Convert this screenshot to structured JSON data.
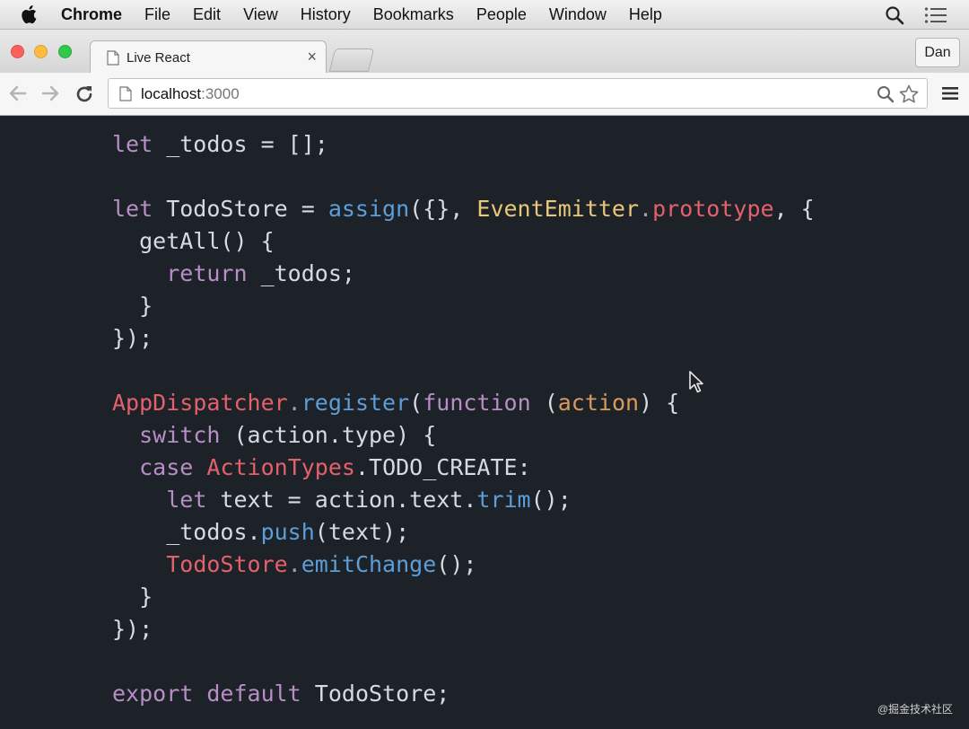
{
  "menubar": {
    "app_name": "Chrome",
    "items": [
      "File",
      "Edit",
      "View",
      "History",
      "Bookmarks",
      "People",
      "Window",
      "Help"
    ]
  },
  "browser": {
    "tab_title": "Live React",
    "tab_close": "×",
    "profile_name": "Dan",
    "url_host": "localhost",
    "url_port": ":3000"
  },
  "icons": {
    "apple": "apple-icon",
    "spotlight": "search-icon",
    "notifications": "list-icon",
    "back": "back-arrow-icon",
    "forward": "forward-arrow-icon",
    "reload": "reload-icon",
    "zoom": "magnifier-icon",
    "star": "star-icon",
    "menu": "hamburger-icon"
  },
  "code_lines": [
    [
      [
        "let",
        "kw"
      ],
      [
        " _todos = [];",
        "plain"
      ]
    ],
    [],
    [
      [
        "let",
        "kw"
      ],
      [
        " TodoStore = ",
        "plain"
      ],
      [
        "assign",
        "fn"
      ],
      [
        "({}, ",
        "plain"
      ],
      [
        "EventEmitter",
        "cls"
      ],
      [
        ".",
        "punct"
      ],
      [
        "prototype",
        "red"
      ],
      [
        ", {",
        "plain"
      ]
    ],
    [
      [
        "  getAll() {",
        "plain"
      ]
    ],
    [
      [
        "    ",
        "plain"
      ],
      [
        "return",
        "ret"
      ],
      [
        " _todos;",
        "plain"
      ]
    ],
    [
      [
        "  }",
        "plain"
      ]
    ],
    [
      [
        "});",
        "plain"
      ]
    ],
    [],
    [
      [
        "AppDispatcher",
        "red"
      ],
      [
        ".",
        "punct"
      ],
      [
        "register",
        "fn"
      ],
      [
        "(",
        "plain"
      ],
      [
        "function",
        "kw"
      ],
      [
        " (",
        "plain"
      ],
      [
        "action",
        "orange"
      ],
      [
        ") {",
        "plain"
      ]
    ],
    [
      [
        "  ",
        "plain"
      ],
      [
        "switch",
        "kw"
      ],
      [
        " (action.type) {",
        "plain"
      ]
    ],
    [
      [
        "  ",
        "plain"
      ],
      [
        "case",
        "kw"
      ],
      [
        " ",
        "plain"
      ],
      [
        "ActionTypes",
        "red"
      ],
      [
        ".TODO_CREATE:",
        "plain"
      ]
    ],
    [
      [
        "    ",
        "plain"
      ],
      [
        "let",
        "kw"
      ],
      [
        " text = action.text.",
        "plain"
      ],
      [
        "trim",
        "fn"
      ],
      [
        "();",
        "plain"
      ]
    ],
    [
      [
        "    _todos.",
        "plain"
      ],
      [
        "push",
        "fn"
      ],
      [
        "(text);",
        "plain"
      ]
    ],
    [
      [
        "    ",
        "plain"
      ],
      [
        "TodoStore",
        "red"
      ],
      [
        ".",
        "punct"
      ],
      [
        "emitChange",
        "fn"
      ],
      [
        "();",
        "plain"
      ]
    ],
    [
      [
        "  }",
        "plain"
      ]
    ],
    [
      [
        "});",
        "plain"
      ]
    ],
    [],
    [
      [
        "export",
        "kw"
      ],
      [
        " ",
        "plain"
      ],
      [
        "default",
        "kw"
      ],
      [
        " TodoStore;",
        "plain"
      ]
    ]
  ],
  "watermark": "@掘金技术社区",
  "colors": {
    "editor_bg": "#1d2228",
    "keyword": "#b78ec6",
    "function": "#5d9dd8",
    "class": "#e8c77a",
    "identifier_red": "#e4606b",
    "param": "#d99a5e",
    "text": "#d7dae0"
  }
}
